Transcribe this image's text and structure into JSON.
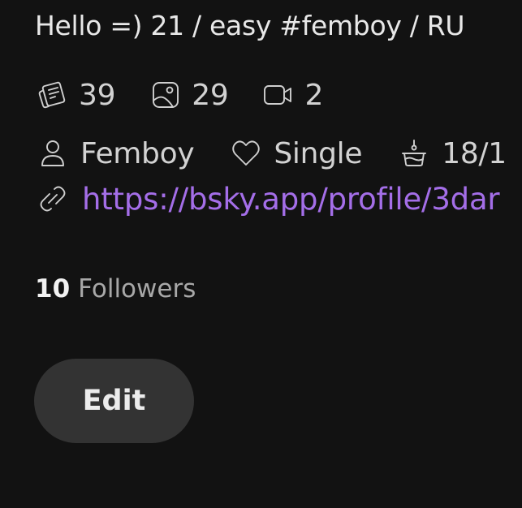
{
  "profile": {
    "bio": "Hello =) 21 / easy #femboy / RU",
    "stats": [
      {
        "icon": "posts-icon",
        "value": "39"
      },
      {
        "icon": "media-icon",
        "value": "29"
      },
      {
        "icon": "video-icon",
        "value": "2"
      }
    ],
    "info": {
      "gender": "Femboy",
      "relationship": "Single",
      "birthday": "18/1"
    },
    "link": "https://bsky.app/profile/3dar",
    "followers_count": "10",
    "followers_label": "Followers",
    "edit_label": "Edit"
  },
  "colors": {
    "background": "#121212",
    "link": "#a46ee8",
    "button": "#333333"
  }
}
